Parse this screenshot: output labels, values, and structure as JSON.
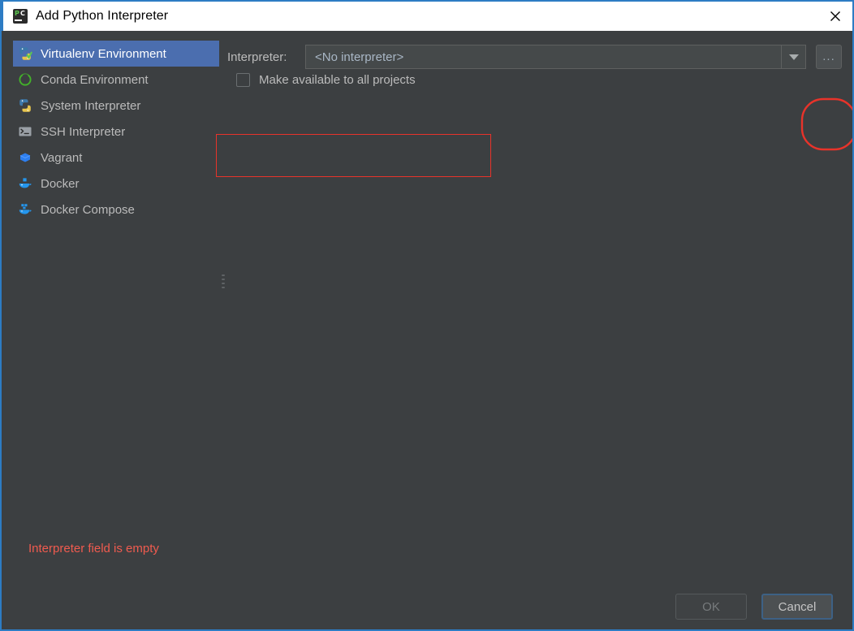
{
  "window": {
    "title": "Add Python Interpreter",
    "app_icon": "pycharm-icon",
    "close_icon": "close-icon"
  },
  "sidebar": {
    "items": [
      {
        "label": "Virtualenv Environment",
        "icon": "virtualenv-icon",
        "selected": true
      },
      {
        "label": "Conda Environment",
        "icon": "conda-icon",
        "selected": false
      },
      {
        "label": "System Interpreter",
        "icon": "python-icon",
        "selected": false
      },
      {
        "label": "SSH Interpreter",
        "icon": "terminal-icon",
        "selected": false
      },
      {
        "label": "Vagrant",
        "icon": "vagrant-cube-icon",
        "selected": false
      },
      {
        "label": "Docker",
        "icon": "docker-whale-icon",
        "selected": false
      },
      {
        "label": "Docker Compose",
        "icon": "docker-compose-icon",
        "selected": false
      }
    ]
  },
  "main": {
    "interpreter_label": "Interpreter:",
    "interpreter_value": "<No interpreter>",
    "interpreter_placeholder": "<No interpreter>",
    "dropdown_icon": "chevron-down-icon",
    "browse_button_label": "...",
    "checkbox_label": "Make available to all projects",
    "checkbox_checked": false,
    "error_message": "Interpreter field is empty"
  },
  "footer": {
    "ok_label": "OK",
    "ok_enabled": false,
    "cancel_label": "Cancel",
    "cancel_focused": true
  },
  "colors": {
    "background": "#3c3f41",
    "selection": "#4b6eaf",
    "accent_border": "#2d7cc4",
    "error_text": "#f05b4f",
    "annotation": "#e8332a",
    "text": "#bbbbbb",
    "field_text": "#a9b7c6"
  }
}
